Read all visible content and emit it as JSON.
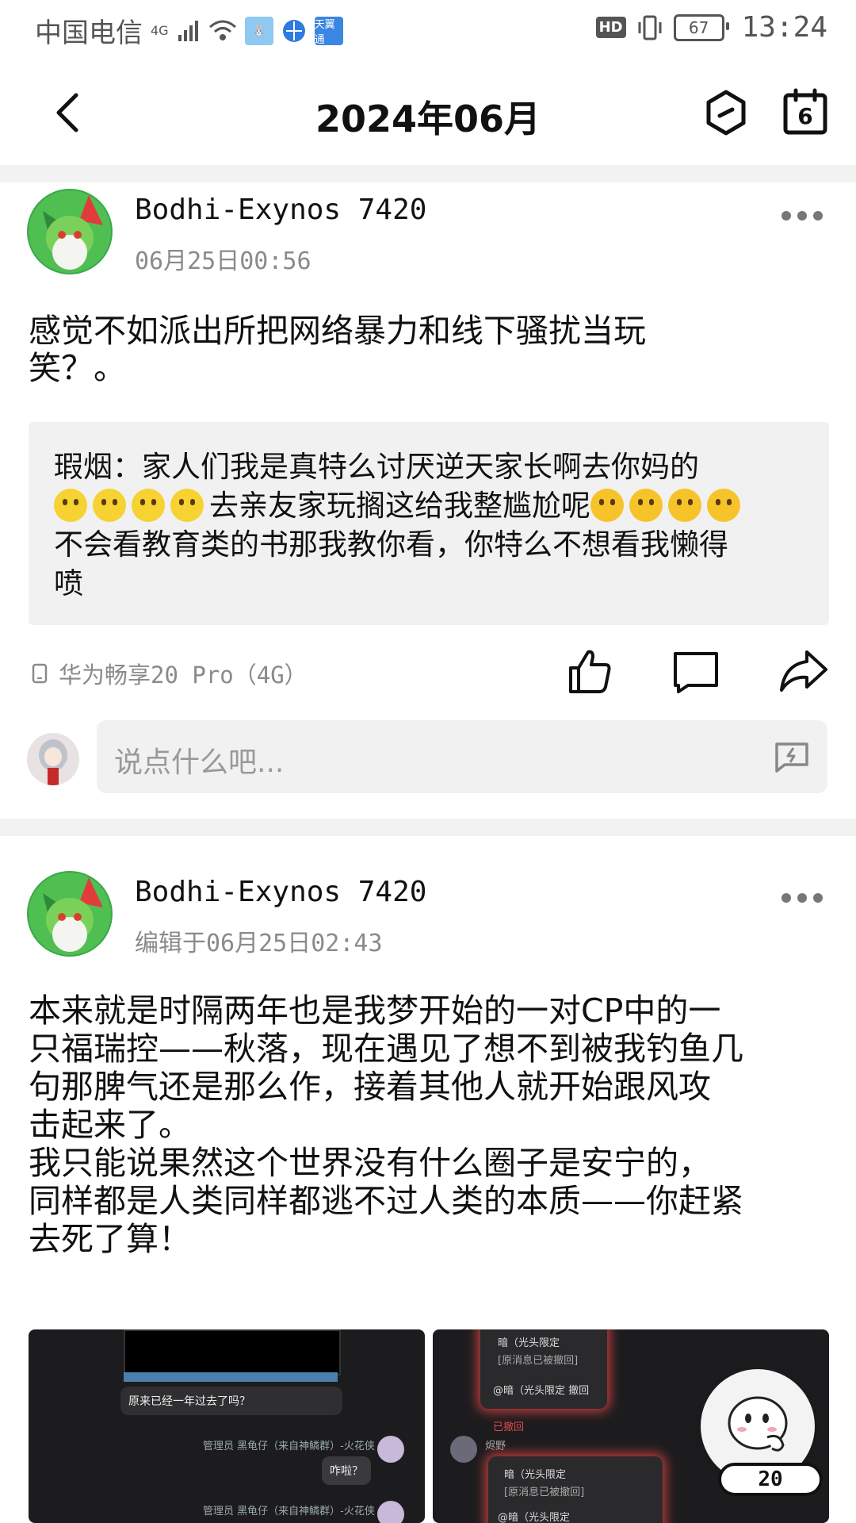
{
  "status_bar": {
    "carrier": "中国电信",
    "network": "4G",
    "app_badge": "天翼通",
    "hd": "HD",
    "battery": "67",
    "time": "13:24"
  },
  "header": {
    "title": "2024年06月",
    "calendar_day": "6"
  },
  "post1": {
    "author": "Bodhi-Exynos 7420",
    "timestamp": "06月25日00:56",
    "content": "感觉不如派出所把网络暴力和线下骚扰当玩\n笑？。",
    "quote": {
      "line1": "瑕烟：家人们我是真特么讨厌逆天家长啊去你妈的",
      "line2": "去亲友家玩搁这给我整尴尬呢",
      "line3": "不会看教育类的书那我教你看，你特么不想看我懒得\n喷"
    },
    "device": "华为畅享20 Pro（4G）",
    "comment_placeholder": "说点什么吧..."
  },
  "post2": {
    "author": "Bodhi-Exynos 7420",
    "timestamp": "编辑于06月25日02:43",
    "content": "本来就是时隔两年也是我梦开始的一对CP中的一\n只福瑞控——秋落，现在遇见了想不到被我钓鱼几\n句那脾气还是那么作，接着其他人就开始跟风攻\n击起来了。\n我只能说果然这个世界没有什么圈子是安宁的，\n同样都是人类同样都逃不过人类的本质——你赶紧\n去死了算！",
    "image1": {
      "caption": "原来已经一年过去了吗？",
      "sender": "管理员  黑龟仔（来自神鳞群）-火花侠",
      "reply": "咋啦？"
    },
    "image2": {
      "quote1": "暗（光头限定",
      "quote1b": "[原消息已被撤回]",
      "reply1": "@暗（光头限定 撤回",
      "recalled": "已撤回",
      "name": "烬野",
      "quote2": "暗（光头限定",
      "quote2b": "[原消息已被撤回]",
      "reply2": "@暗（光头限定"
    }
  },
  "fab": {
    "count": "20"
  },
  "colors": {
    "divider": "#f2f2f2",
    "quote_bg": "#f1f1f1",
    "muted_text": "#8a8a8a"
  }
}
